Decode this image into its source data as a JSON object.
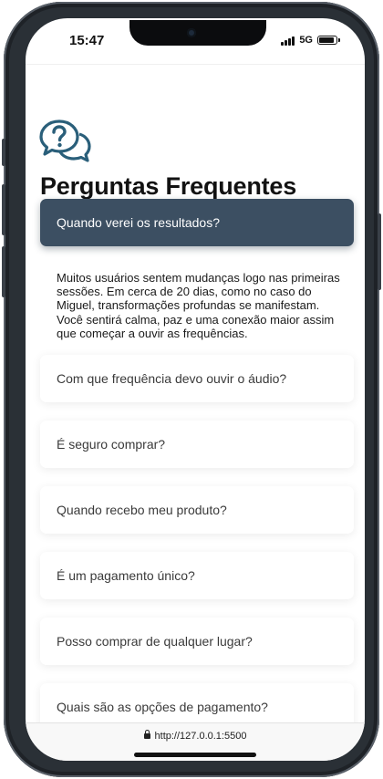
{
  "status_bar": {
    "time": "15:47",
    "network": "5G",
    "icons": [
      "signal-icon",
      "battery-icon"
    ]
  },
  "page": {
    "icon": "question-chat-icon",
    "title": "Perguntas Frequentes"
  },
  "faq": {
    "items": [
      {
        "question": "Quando verei os resultados?",
        "expanded": true,
        "answer": "Muitos usuários sentem mudanças logo nas primeiras sessões. Em cerca de 20 dias, como no caso do Miguel, transformações profundas se manifestam. Você sentirá calma, paz e uma conexão maior assim que começar a ouvir as frequências."
      },
      {
        "question": "Com que frequência devo ouvir o áudio?",
        "expanded": false
      },
      {
        "question": "É seguro comprar?",
        "expanded": false
      },
      {
        "question": "Quando recebo meu produto?",
        "expanded": false
      },
      {
        "question": "É um pagamento único?",
        "expanded": false
      },
      {
        "question": "Posso comprar de qualquer lugar?",
        "expanded": false
      },
      {
        "question": "Quais são as opções de pagamento?",
        "expanded": false
      }
    ]
  },
  "browser": {
    "url": "http://127.0.0.1:5500",
    "icon": "lock-icon"
  },
  "colors": {
    "accent": "#3c4f62",
    "icon_teal": "#2a5f7a",
    "phone_frame": "#2a3036"
  }
}
